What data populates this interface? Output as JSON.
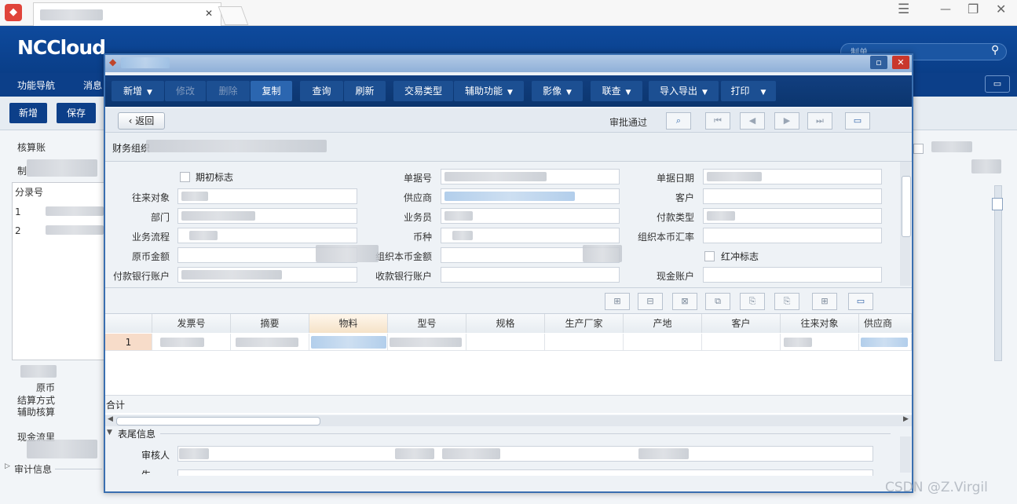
{
  "browser": {
    "close_tab": "✕",
    "menu_icon": "☰",
    "minimize_icon": "—",
    "restore_icon": "❐",
    "close_icon": "✕"
  },
  "app": {
    "brand": "NCCloud",
    "search_placeholder": "制单",
    "nav": [
      "功能导航",
      "消息"
    ],
    "toolbar": [
      "新增",
      "保存"
    ],
    "labels": {
      "account": "核算账",
      "maker": "制",
      "entry_no": "分录号",
      "row1": "1",
      "row2": "2",
      "currency": "原币",
      "settle": "结算方式",
      "aux": "辅助核算",
      "cashflow": "现金流里",
      "audit": "审计信息"
    }
  },
  "modal": {
    "window_buttons": {
      "restore": "▫",
      "close": "✕"
    },
    "toolbar": [
      {
        "label": "新增",
        "caret": true,
        "state": "normal"
      },
      {
        "label": "修改",
        "caret": false,
        "state": "disabled"
      },
      {
        "label": "删除",
        "caret": false,
        "state": "disabled"
      },
      {
        "label": "复制",
        "caret": false,
        "state": "selected"
      },
      {
        "label": "查询",
        "caret": false,
        "state": "normal"
      },
      {
        "label": "刷新",
        "caret": false,
        "state": "normal"
      },
      {
        "label": "交易类型",
        "caret": false,
        "state": "normal"
      },
      {
        "label": "辅助功能",
        "caret": true,
        "state": "normal"
      },
      {
        "label": "影像",
        "caret": true,
        "state": "normal"
      },
      {
        "label": "联查",
        "caret": true,
        "state": "normal"
      },
      {
        "label": "导入导出",
        "caret": true,
        "state": "normal"
      },
      {
        "label": "打印",
        "caret": true,
        "state": "normal"
      }
    ],
    "back_label": "返回",
    "approval_status": "审批通过",
    "org_label": "财务组织",
    "form": {
      "opening_flag": "期初标志",
      "counterparty": "往来对象",
      "department": "部门",
      "business_flow": "业务流程",
      "original_amount": "原币金额",
      "pay_bank_account": "付款银行账户",
      "bill_no": "单据号",
      "supplier": "供应商",
      "salesman": "业务员",
      "currency": "币种",
      "org_local_amount": "组织本币金额",
      "recv_bank_account": "收款银行账户",
      "bill_date": "单据日期",
      "customer": "客户",
      "pay_type": "付款类型",
      "org_local_rate": "组织本币汇率",
      "red_flag": "红冲标志",
      "cash_account": "现金账户"
    },
    "grid": {
      "headers": [
        "发票号",
        "摘要",
        "物料",
        "型号",
        "规格",
        "生产厂家",
        "产地",
        "客户",
        "往来对象",
        "供应商"
      ],
      "row_no": "1",
      "total_label": "合计"
    },
    "footer": {
      "section_title": "表尾信息",
      "reviewer": "审核人",
      "second_label": "生"
    }
  },
  "watermark": "CSDN @Z.Virgil"
}
